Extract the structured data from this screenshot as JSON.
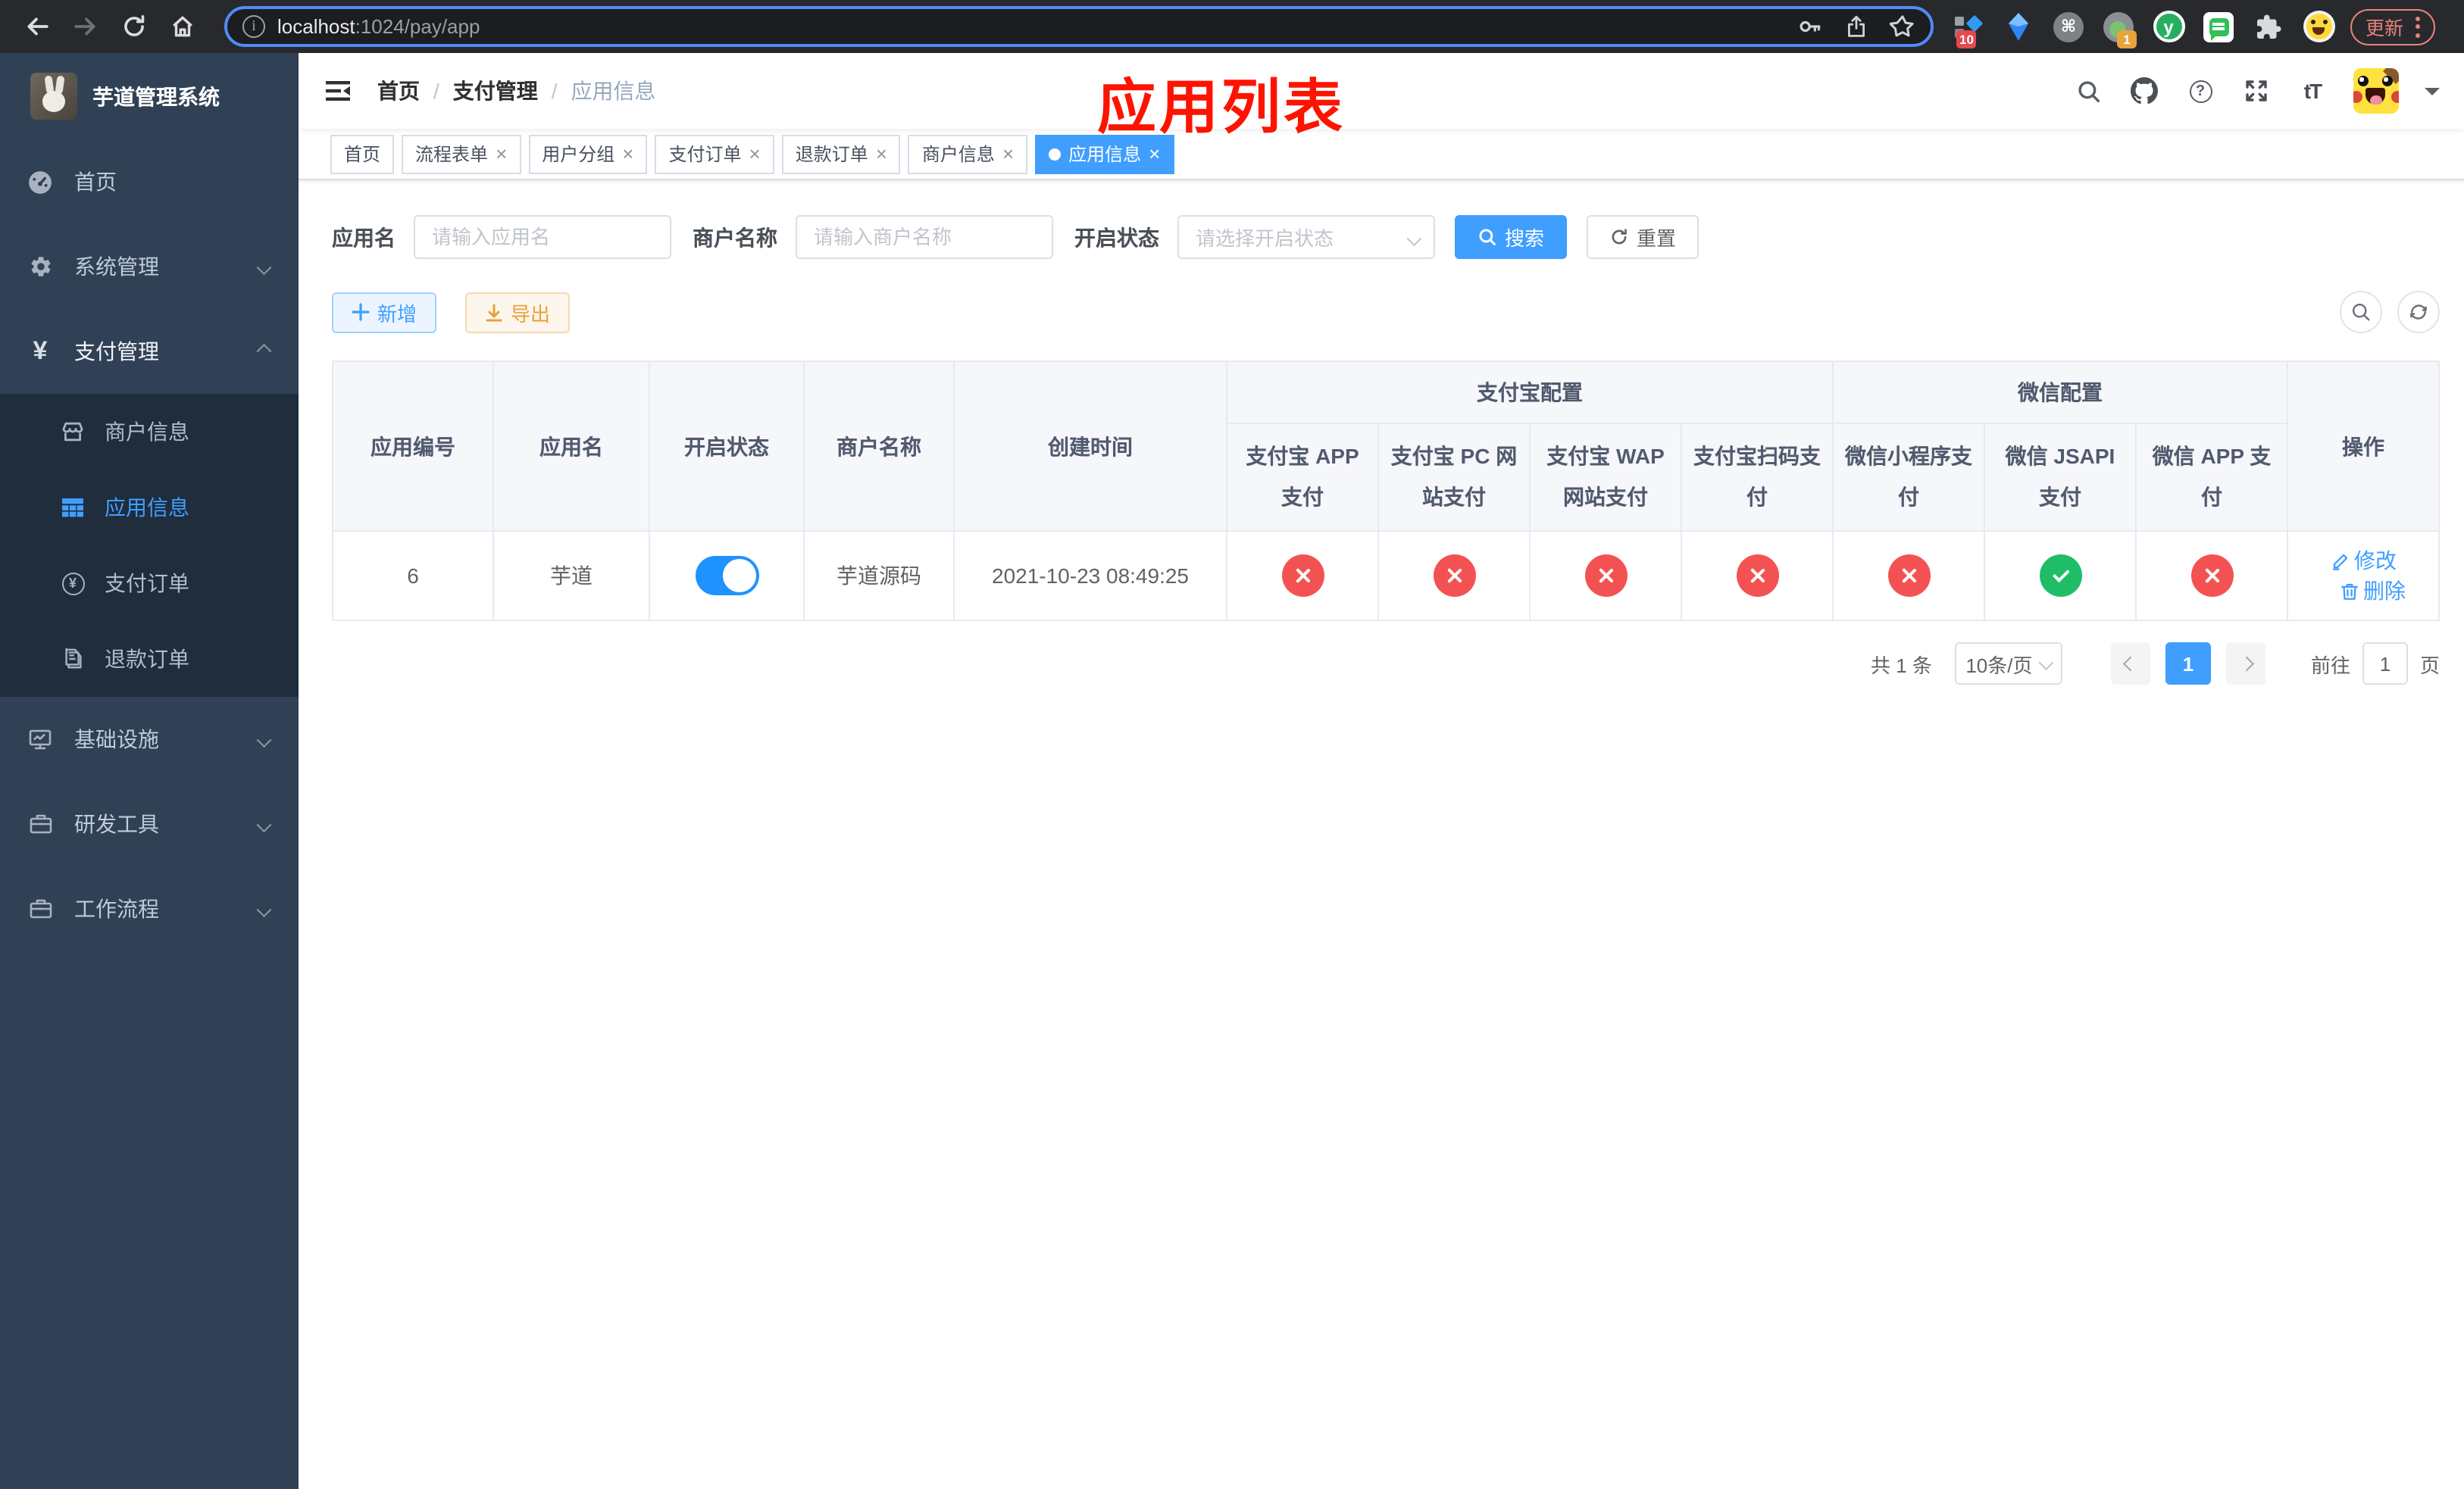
{
  "browser": {
    "url_host": "localhost",
    "url_rest": ":1024/pay/app",
    "ext_badge_a": "10",
    "ext_badge_b": "1",
    "ext_y_letter": "y",
    "update_label": "更新"
  },
  "icons": {
    "info": "i",
    "command": "⌘",
    "question": "?",
    "font_size": "tT",
    "yen": "¥",
    "close": "×",
    "breadcrumb_sep": "/"
  },
  "sidebar": {
    "app_title": "芋道管理系统",
    "items": [
      {
        "label": "首页"
      },
      {
        "label": "系统管理"
      },
      {
        "label": "支付管理"
      },
      {
        "label": "商户信息"
      },
      {
        "label": "应用信息"
      },
      {
        "label": "支付订单"
      },
      {
        "label": "退款订单"
      },
      {
        "label": "基础设施"
      },
      {
        "label": "研发工具"
      },
      {
        "label": "工作流程"
      }
    ]
  },
  "header": {
    "breadcrumb": [
      "首页",
      "支付管理",
      "应用信息"
    ],
    "annotation": "应用列表"
  },
  "tabs": [
    {
      "label": "首页"
    },
    {
      "label": "流程表单"
    },
    {
      "label": "用户分组"
    },
    {
      "label": "支付订单"
    },
    {
      "label": "退款订单"
    },
    {
      "label": "商户信息"
    },
    {
      "label": "应用信息"
    }
  ],
  "filters": {
    "app_name_label": "应用名",
    "app_name_placeholder": "请输入应用名",
    "merchant_label": "商户名称",
    "merchant_placeholder": "请输入商户名称",
    "status_label": "开启状态",
    "status_placeholder": "请选择开启状态",
    "search_label": "搜索",
    "reset_label": "重置"
  },
  "toolbar": {
    "add_label": "新增",
    "export_label": "导出"
  },
  "table": {
    "groups": {
      "alipay": "支付宝配置",
      "wechat": "微信配置"
    },
    "columns_left": [
      "应用编号",
      "应用名",
      "开启状态",
      "商户名称",
      "创建时间"
    ],
    "columns_alipay": [
      "支付宝 APP 支付",
      "支付宝 PC 网站支付",
      "支付宝 WAP 网站支付",
      "支付宝扫码支付"
    ],
    "columns_wechat": [
      "微信小程序支付",
      "微信 JSAPI 支付",
      "微信 APP 支付"
    ],
    "op_label": "操作",
    "row": {
      "id": "6",
      "name": "芋道",
      "enabled": true,
      "merchant": "芋道源码",
      "created": "2021-10-23 08:49:25",
      "pay_status": [
        "no",
        "no",
        "no",
        "no",
        "no",
        "yes",
        "no"
      ],
      "edit_label": "修改",
      "delete_label": "删除"
    }
  },
  "pagination": {
    "total": "共 1 条",
    "size": "10条/页",
    "page": "1",
    "goto_label": "前往",
    "goto_value": "1",
    "unit": "页"
  },
  "colors": {
    "accent": "#409EFF",
    "danger": "#f45252",
    "success": "#1fbe66",
    "warning": "#e6a23c",
    "annotation": "#fe1300",
    "switch_on": "#1e93ff",
    "update": "#e8837a"
  }
}
